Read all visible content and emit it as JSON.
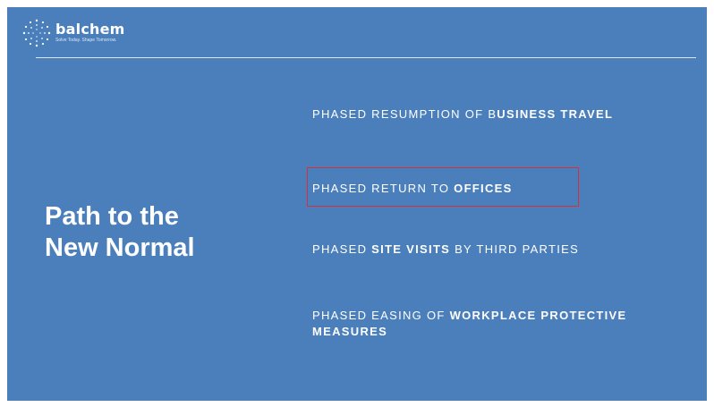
{
  "brand": {
    "name": "balchem",
    "tagline": "Solve Today. Shape Tomorrow.",
    "logo_icon": "dotted-sunburst-icon"
  },
  "title": {
    "line1": "Path to the",
    "line2": "New Normal"
  },
  "items": [
    {
      "normal": "PHASED RESUMPTION OF B",
      "bold": "USINESS TRAVEL",
      "tail": ""
    },
    {
      "normal": "PHASED RETURN TO ",
      "bold": "OFFICES",
      "tail": ""
    },
    {
      "normal": "PHASED ",
      "bold": "SITE VISITS",
      "tail": " BY THIRD PARTIES"
    },
    {
      "normal": "PHASED EASING OF ",
      "bold": "WORKPLACE PROTECTIVE MEASURES",
      "tail": ""
    }
  ],
  "colors": {
    "background": "#4a7fbc",
    "text": "#ffffff",
    "highlight": "#d8303a"
  }
}
